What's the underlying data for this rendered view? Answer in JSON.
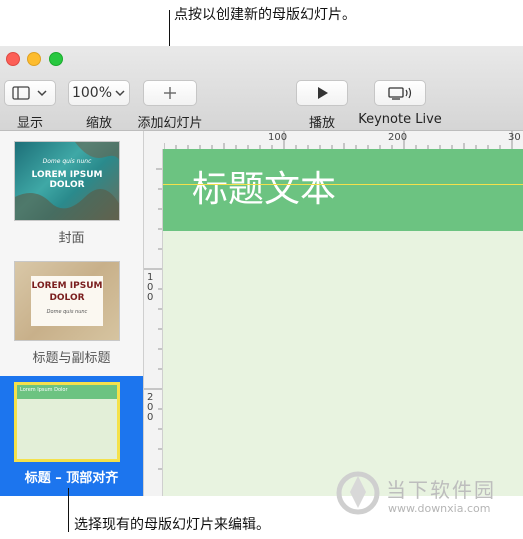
{
  "callouts": {
    "top": "点按以创建新的母版幻灯片。",
    "bottom": "选择现有的母版幻灯片来编辑。"
  },
  "toolbar": {
    "view_label": "显示",
    "zoom_value": "100%",
    "zoom_label": "缩放",
    "add_label": "添加幻灯片",
    "play_label": "播放",
    "keynote_live_label": "Keynote Live"
  },
  "sidebar": {
    "slides": [
      {
        "label": "封面",
        "thumb_script": "Dome quis nunc",
        "thumb_title": "LOREM IPSUM DOLOR"
      },
      {
        "label": "标题与副标题",
        "thumb_title_1": "LOREM IPSUM",
        "thumb_title_2": "DOLOR",
        "thumb_subtitle": "Dome quis nunc"
      },
      {
        "label": "标题 – 顶部对齐",
        "thumb_title": "Lorem Ipsum Dolor"
      }
    ]
  },
  "rulers": {
    "top": [
      "100",
      "200",
      "30"
    ],
    "left_1": [
      "1",
      "0",
      "0"
    ],
    "left_2": [
      "2",
      "0",
      "0"
    ]
  },
  "canvas": {
    "title_placeholder": "标题文本"
  },
  "watermark": {
    "cn": "当下软件园",
    "url": "www.downxia.com"
  },
  "colors": {
    "selection": "#1c75ee",
    "title_band": "#6cc381",
    "canvas_bg": "#e8f3e0",
    "guide": "#f4e14b"
  }
}
